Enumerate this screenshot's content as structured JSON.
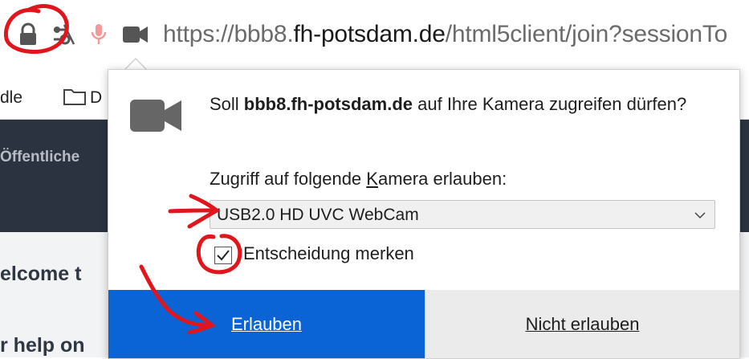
{
  "urlbar": {
    "url_prefix": "https://bbb8.",
    "url_host": "fh-potsdam.de",
    "url_path": "/html5client/join?sessionTo",
    "icons": [
      "lock-icon",
      "permissions-icon",
      "microphone-icon",
      "camera-icon"
    ]
  },
  "bookmarks": {
    "partial_item": "dle",
    "folder_label": "D"
  },
  "page": {
    "tab_text": "Öffentliche",
    "welcome_text": "elcome t",
    "help_text": "r help on"
  },
  "dialog": {
    "question_prefix": "Soll ",
    "question_host": "bbb8.fh-potsdam.de",
    "question_suffix": " auf Ihre Kamera zugreifen dürfen?",
    "camera_label_before": "Zugriff auf folgende ",
    "camera_label_accesskey": "K",
    "camera_label_after": "amera erlauben:",
    "camera_selected": "USB2.0 HD UVC WebCam",
    "remember_label": "Entscheidung merken",
    "remember_checked": true,
    "allow_label": "Erlauben",
    "deny_label": "Nicht erlauben",
    "colors": {
      "allow_button": "#0a64d6",
      "deny_button": "#ebebeb",
      "annotation": "#e0161c"
    }
  }
}
